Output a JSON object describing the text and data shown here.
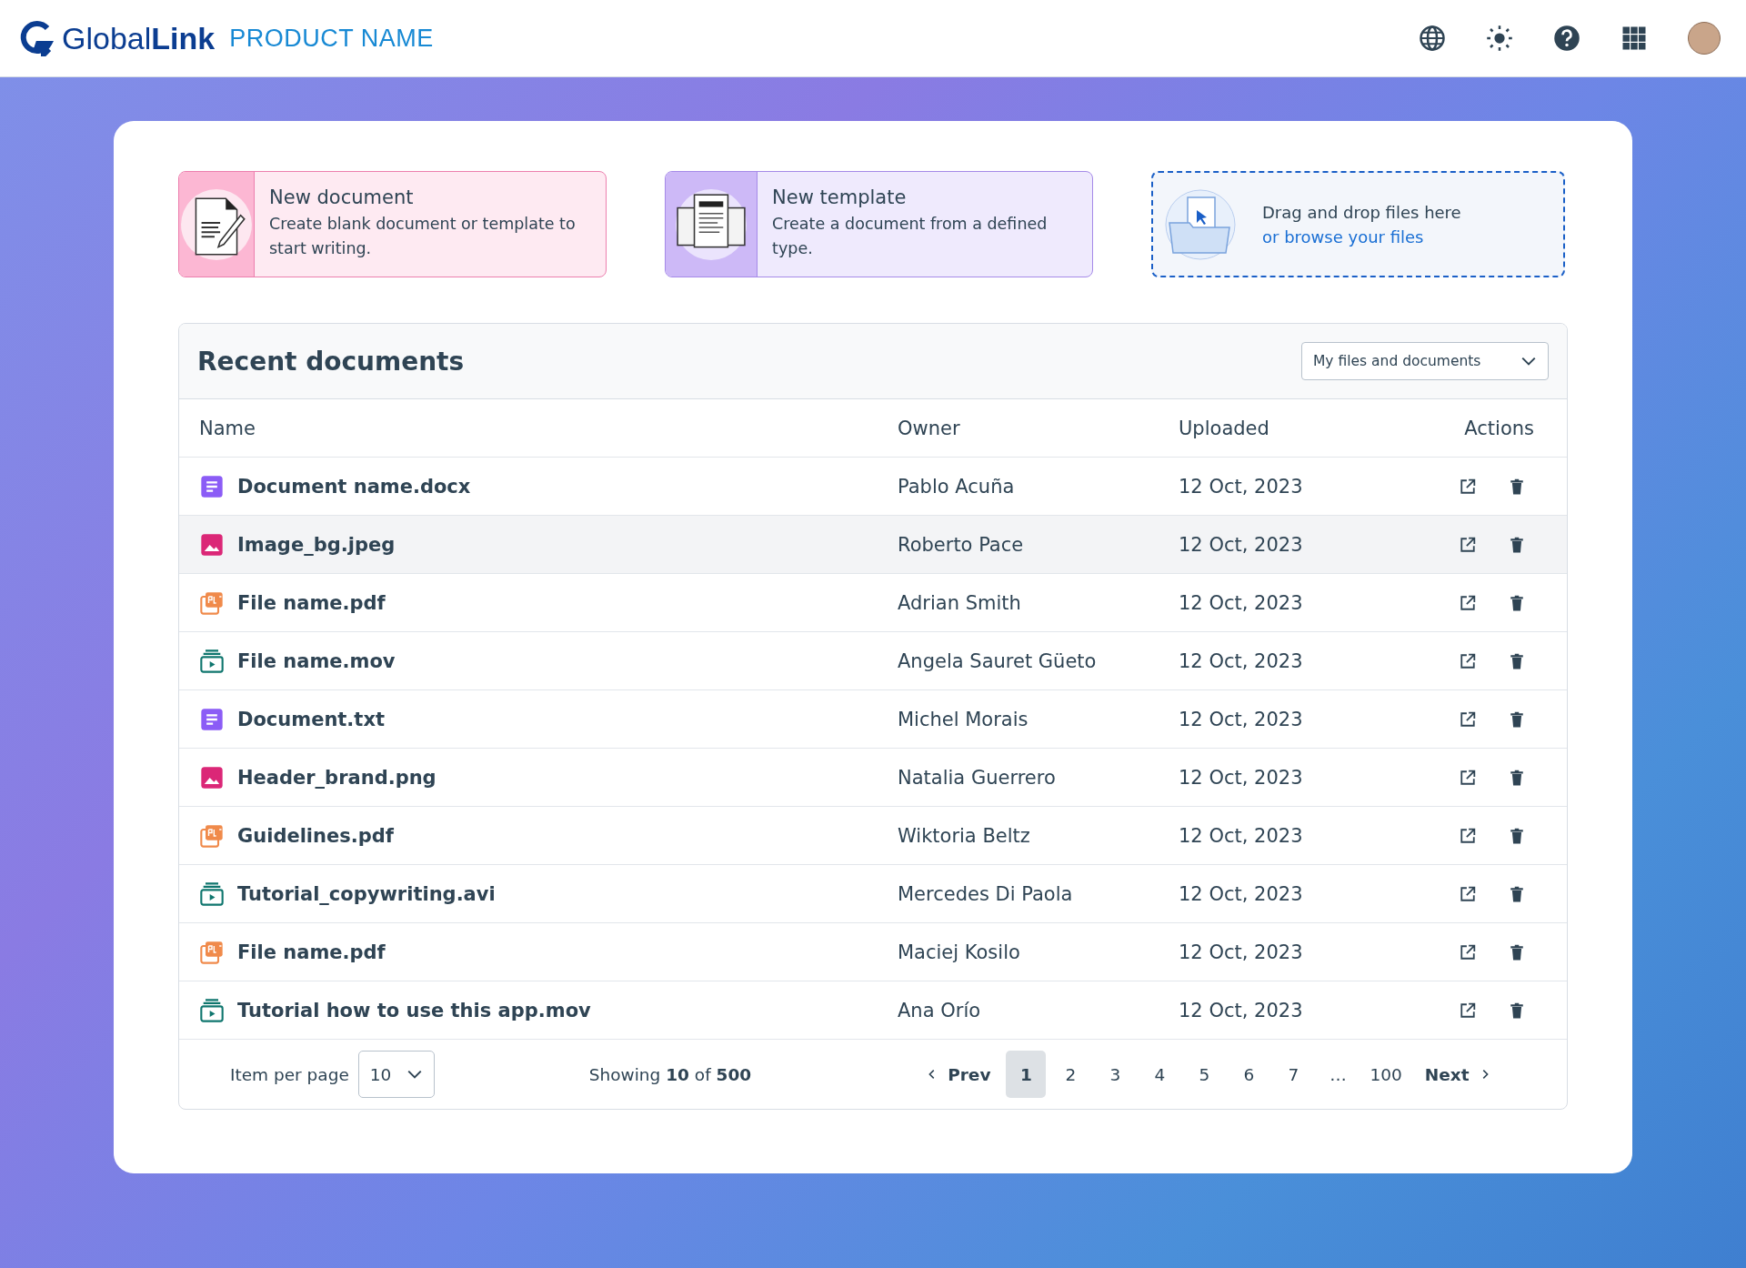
{
  "header": {
    "logo": "Global**Link**",
    "product": "PRODUCT NAME"
  },
  "actions": [
    {
      "kind": "document",
      "title": "New document",
      "text": "Create blank document or template to start writing."
    },
    {
      "kind": "template",
      "title": "New template",
      "text": "Create a document from a defined type."
    },
    {
      "kind": "upload",
      "text": "Drag and drop files here",
      "link": "or browse your files"
    }
  ],
  "recent": {
    "title": "Recent documents",
    "filter": "My files and documents",
    "columns": [
      "Name",
      "Owner",
      "Uploaded",
      "Actions"
    ],
    "rows": [
      {
        "kind": "doc",
        "name": "Document name.docx",
        "owner": "Pablo Acuña",
        "uploaded": "12 Oct, 2023",
        "highlighted": false
      },
      {
        "kind": "image",
        "name": "Image_bg.jpeg",
        "owner": "Roberto Pace",
        "uploaded": "12 Oct, 2023",
        "highlighted": true
      },
      {
        "kind": "pdf",
        "name": "File name.pdf",
        "owner": "Adrian Smith",
        "uploaded": "12 Oct, 2023",
        "highlighted": false
      },
      {
        "kind": "video",
        "name": "File name.mov",
        "owner": "Angela Sauret Güeto",
        "uploaded": "12 Oct, 2023",
        "highlighted": false
      },
      {
        "kind": "doc",
        "name": "Document.txt",
        "owner": "Michel Morais",
        "uploaded": "12 Oct, 2023",
        "highlighted": false
      },
      {
        "kind": "image",
        "name": "Header_brand.png",
        "owner": "Natalia Guerrero",
        "uploaded": "12 Oct, 2023",
        "highlighted": false
      },
      {
        "kind": "pdf",
        "name": "Guidelines.pdf",
        "owner": "Wiktoria Beltz",
        "uploaded": "12 Oct, 2023",
        "highlighted": false
      },
      {
        "kind": "video",
        "name": "Tutorial_copywriting.avi",
        "owner": "Mercedes Di Paola",
        "uploaded": "12 Oct, 2023",
        "highlighted": false
      },
      {
        "kind": "pdf",
        "name": "File name.pdf",
        "owner": "Maciej Kosilo",
        "uploaded": "12 Oct, 2023",
        "highlighted": false
      },
      {
        "kind": "video",
        "name": "Tutorial how to use this app.mov",
        "owner": "Ana Orío",
        "uploaded": "12 Oct, 2023",
        "highlighted": false
      }
    ],
    "pagination": {
      "per_page_label": "Item per page",
      "per_page": "10",
      "showing": "Showing **10** of **500**",
      "prev": "Prev",
      "next": "Next",
      "pages": [
        {
          "label": "1",
          "selected": true
        },
        {
          "label": "2",
          "selected": false
        },
        {
          "label": "3",
          "selected": false
        },
        {
          "label": "4",
          "selected": false
        },
        {
          "label": "5",
          "selected": false
        },
        {
          "label": "6",
          "selected": false
        },
        {
          "label": "7",
          "selected": false
        },
        {
          "label": "…",
          "selected": false
        },
        {
          "label": "100",
          "selected": false
        }
      ]
    }
  }
}
